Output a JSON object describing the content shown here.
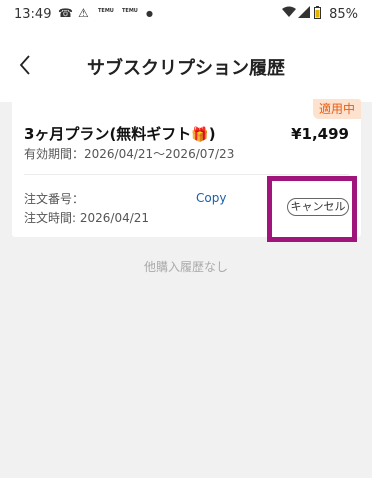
{
  "status_bar": {
    "time": "13:49",
    "app_icon_1": "TEMU",
    "app_icon_2": "TEMU",
    "battery": "85%"
  },
  "header": {
    "title": "サブスクリプション履歴",
    "back_icon": "chevron-left-icon"
  },
  "subscription": {
    "badge": "適用中",
    "plan_name": "3ヶ月プラン(無料ギフト",
    "plan_suffix": ")",
    "price": "¥1,499",
    "validity": "有効期間：2026/04/21〜2026/07/23",
    "order_number_label": "注文番号：",
    "order_time": "注文時間: 2026/04/21",
    "copy_label": "Copy",
    "cancel_label": "キャンセル"
  },
  "empty_message": "他購入履歴なし",
  "colors": {
    "badge_bg": "#fde2cf",
    "badge_text": "#e85d12",
    "link": "#1b5fa8",
    "highlight": "#a0157c",
    "page_bg": "#f1f1f1"
  }
}
